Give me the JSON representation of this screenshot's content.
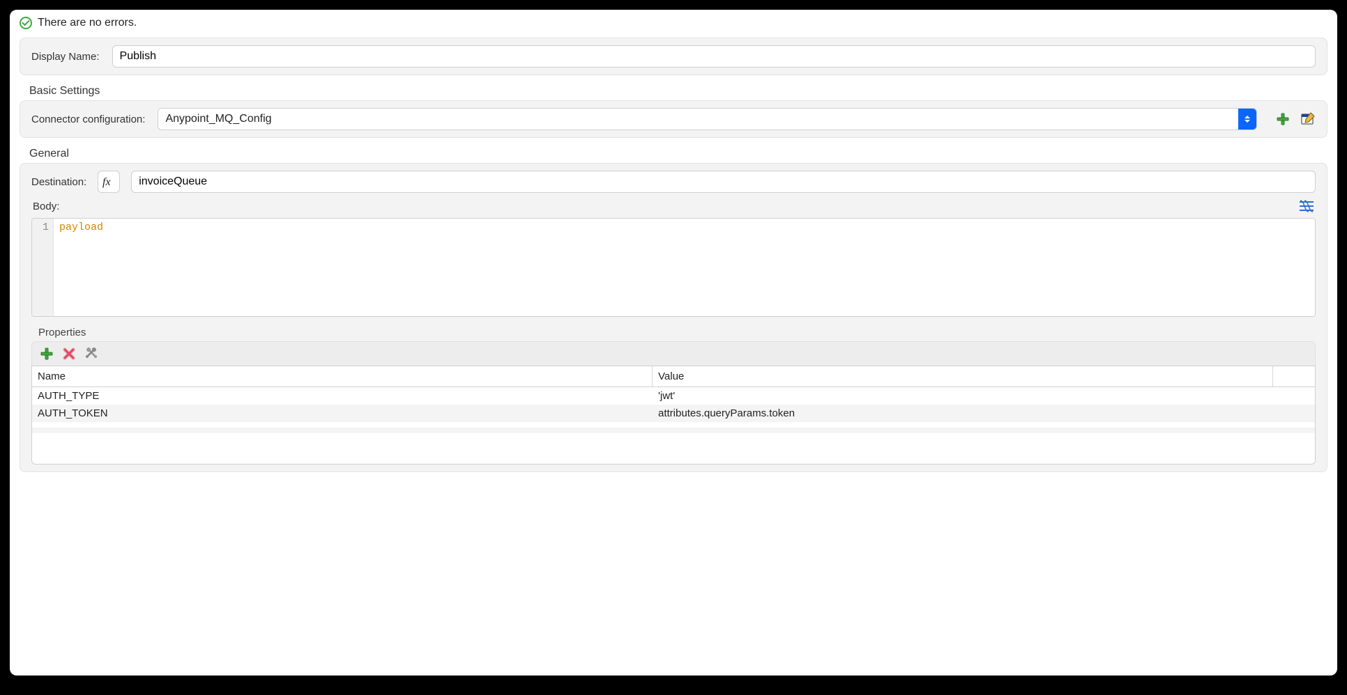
{
  "status": {
    "text": "There are no errors."
  },
  "display_name": {
    "label": "Display Name:",
    "value": "Publish"
  },
  "basic_settings": {
    "title": "Basic Settings",
    "connector_label": "Connector configuration:",
    "connector_value": "Anypoint_MQ_Config"
  },
  "general": {
    "title": "General",
    "destination_label": "Destination:",
    "destination_value": "invoiceQueue",
    "body_label": "Body:",
    "body_code": "payload",
    "properties_title": "Properties",
    "properties_columns": {
      "name": "Name",
      "value": "Value"
    },
    "properties_rows": [
      {
        "name": "AUTH_TYPE",
        "value": "'jwt'"
      },
      {
        "name": "AUTH_TOKEN",
        "value": "attributes.queryParams.token"
      }
    ]
  }
}
